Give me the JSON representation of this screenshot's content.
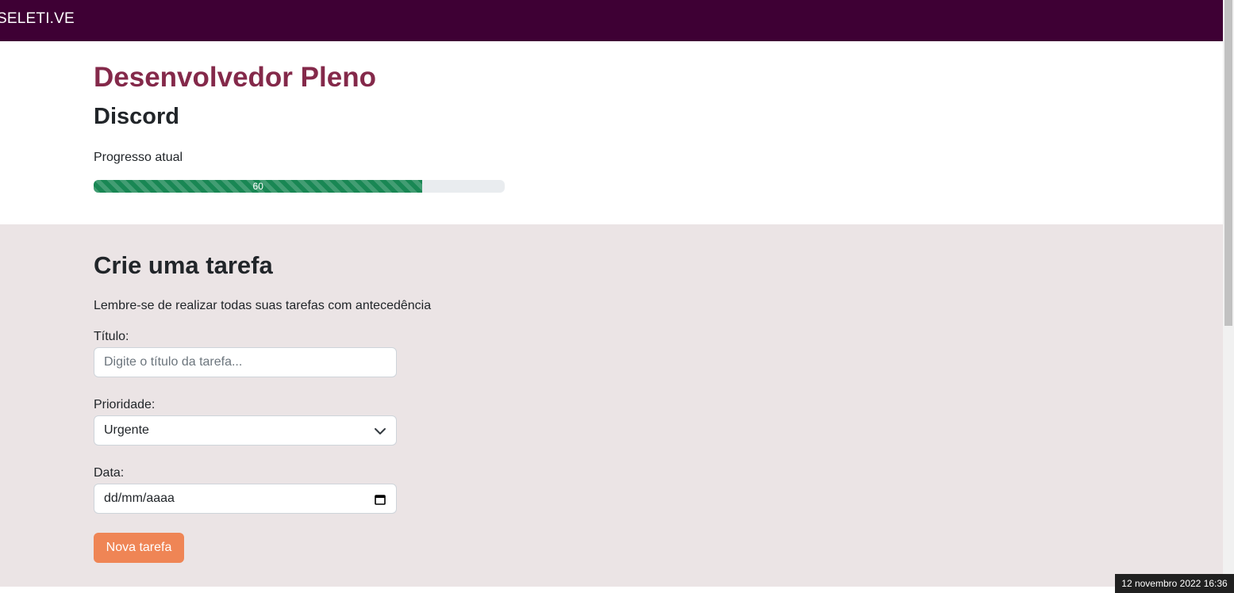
{
  "navbar": {
    "brand": "SELETI.VE",
    "background": "#3e0034"
  },
  "header": {
    "job_title": "Desenvolvedor Pleno",
    "company": "Discord",
    "progress_label": "Progresso atual",
    "progress_value": 80,
    "progress_text": "60",
    "progress_color": "#198754",
    "title_color": "#84294a"
  },
  "form": {
    "title": "Crie uma tarefa",
    "subtitle": "Lembre-se de realizar todas suas tarefas com antecedência",
    "title_field": {
      "label": "Título:",
      "placeholder": "Digite o título da tarefa...",
      "value": ""
    },
    "priority_field": {
      "label": "Prioridade:",
      "selected": "Urgente",
      "icon": "chevron-down-icon"
    },
    "date_field": {
      "label": "Data:",
      "value": "dd/mm/aaaa",
      "icon": "calendar-icon"
    },
    "submit_label": "Nova tarefa",
    "button_color": "#ef8555",
    "background": "#ebe4e5"
  },
  "taskbar": {
    "clock": "12 novembro 2022 16:36"
  }
}
